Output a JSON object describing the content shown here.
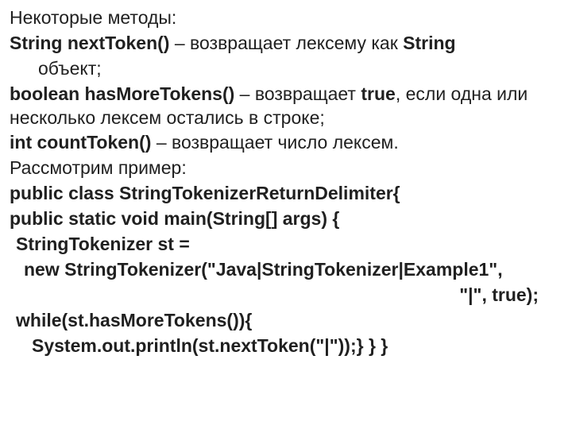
{
  "lines": {
    "l0": "Некоторые методы:",
    "l1a": "String nextToken()",
    "l1b": " – возвращает лексему как ",
    "l1c": "String",
    "l1d": "объект;",
    "l2a": "boolean hasMoreTokens()",
    "l2b": " – возвращает ",
    "l2c": "true",
    "l2d": ", если одна или несколько лексем остались в строке;",
    "l3a": "int countToken()",
    "l3b": " – возвращает число лексем.",
    "l4": "Рассмотрим пример:",
    "l5": "public class StringTokenizerReturnDelimiter{",
    "l6": "public static void main(String[] args) {",
    "l7": "StringTokenizer st =",
    "l8": "new StringTokenizer(\"Java|StringTokenizer|Example1\",",
    "l8tail": "\"|\", true);",
    "l9": "while(st.hasMoreTokens()){",
    "l10": "System.out.println(st.nextToken(\"|\"));} } }"
  }
}
